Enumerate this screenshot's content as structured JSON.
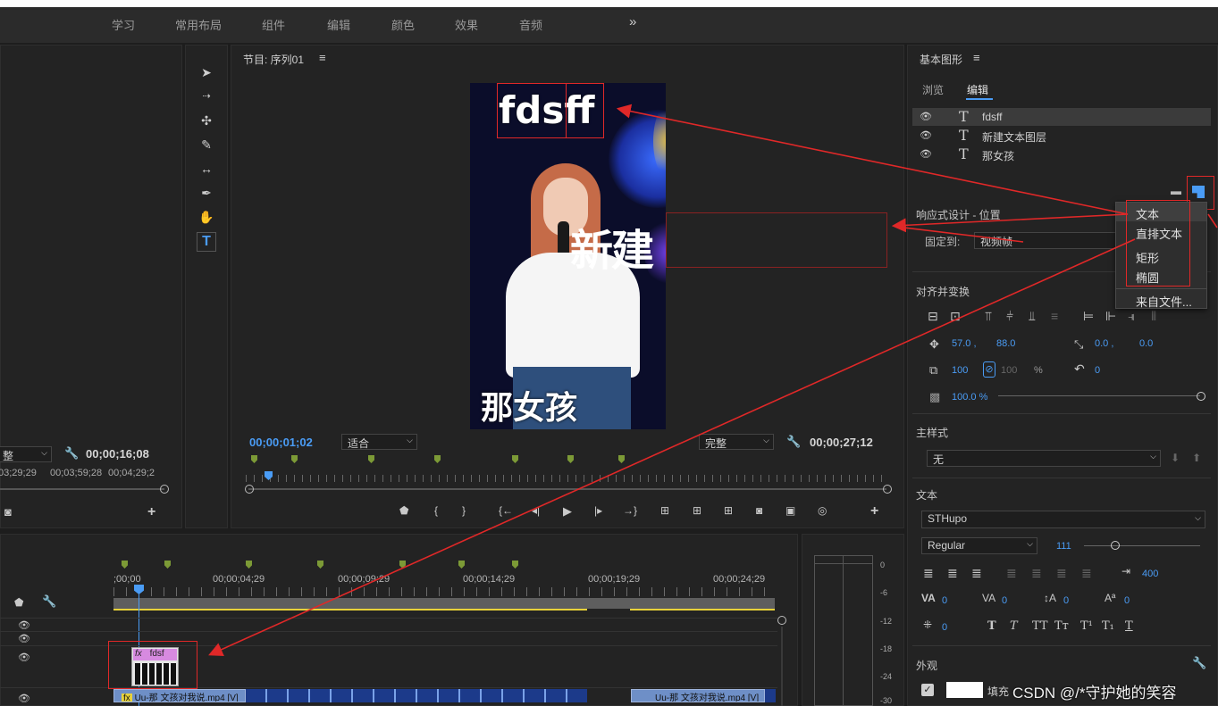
{
  "menu": [
    "学习",
    "常用布局",
    "组件",
    "编辑",
    "颜色",
    "效果",
    "音频"
  ],
  "menu_more": "»",
  "source_panel": {
    "fit_value": "整",
    "timecode": "00;00;16;08",
    "ruler": [
      "03;29;29",
      "00;03;59;28",
      "00;04;29;2"
    ]
  },
  "program_panel": {
    "title": "节目: 序列01",
    "menu_glyph": "≡",
    "current_time": "00;00;01;02",
    "fit": "适合",
    "quality": "完整",
    "duration": "00;00;27;12",
    "video": {
      "title_text": "fdsff",
      "middle_text": "新建",
      "bottom_text": "那女孩"
    }
  },
  "timeline": {
    "start": ";00;00",
    "marks": [
      "00;00;04;29",
      "00;00;09;29",
      "00;00;14;29",
      "00;00;19;29",
      "00;00;24;29"
    ],
    "graphic_clip": "fdsf",
    "graphic_fx": "fx",
    "video_clip_1": "Uu-那 文孩对我说.mp4 [V]",
    "video_clip_2": "Uu-那 文孩对我说.mp4 [V]",
    "meter_scale": [
      "0",
      "-6",
      "-12",
      "-18",
      "-24",
      "-30"
    ]
  },
  "essential_graphics": {
    "title": "基本图形",
    "menu_glyph": "≡",
    "tabs": [
      "浏览",
      "编辑"
    ],
    "active_tab": "编辑",
    "layers": [
      "fdsff",
      "新建文本图层",
      "那女孩"
    ],
    "responsive_label": "响应式设计 - 位置",
    "pin_label": "固定到:",
    "pin_value": "视频帧",
    "align_label": "对齐并变换",
    "pos_x": "57.0 ,",
    "pos_y": "88.0",
    "anchor_x": "0.0 ,",
    "anchor_y": "0.0",
    "scale": "100",
    "scale_h": "100",
    "percent": "%",
    "rotation": "0",
    "opacity": "100.0 %",
    "master_style_label": "主样式",
    "master_style_value": "无",
    "text_label": "文本",
    "font": "STHupo",
    "font_style": "Regular",
    "font_size": "111",
    "tracking": "400",
    "kerning_values": [
      "0",
      "0",
      "0",
      "0"
    ],
    "baseline": "0",
    "style_buttons": [
      "T",
      "T",
      "TT",
      "Tт",
      "T¹",
      "T₁",
      "T"
    ],
    "appearance_label": "外观",
    "fill_label": "填充"
  },
  "context_menu": [
    "文本",
    "直排文本",
    "矩形",
    "椭圆",
    "来自文件..."
  ],
  "watermark": "CSDN @/*守护她的笑容",
  "colors": {
    "accent": "#4a9cf5",
    "annotation": "#e02828",
    "marker": "#7c9a36"
  }
}
